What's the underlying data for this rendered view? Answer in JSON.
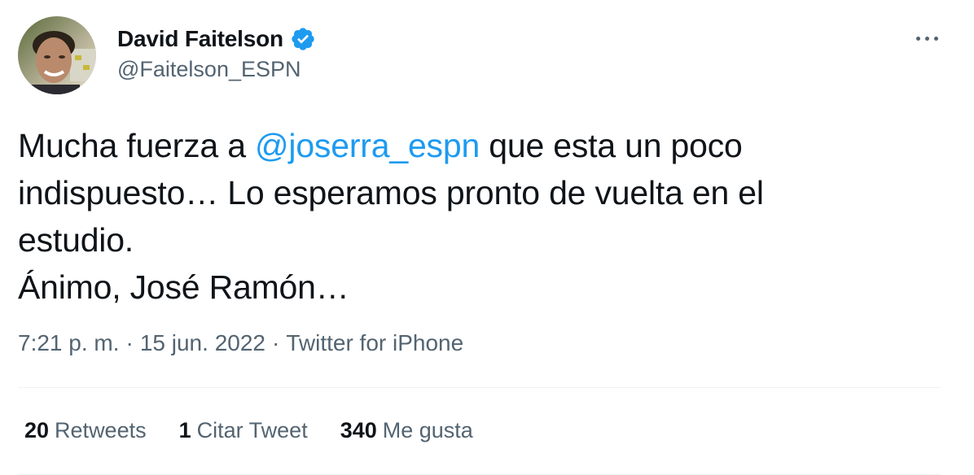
{
  "user": {
    "display_name": "David Faitelson",
    "handle": "@Faitelson_ESPN",
    "verified": true,
    "avatar_icon": "profile-photo"
  },
  "tweet": {
    "text_before_mention": "Mucha fuerza a ",
    "mention": "@joserra_espn",
    "text_after_mention": " que esta un poco",
    "line2": "indispuesto… Lo esperamos pronto de vuelta en el",
    "line3": "estudio.",
    "line4": "Ánimo, José Ramón…"
  },
  "meta": {
    "time": "7:21 p. m.",
    "separator": "·",
    "date": "15 jun. 2022",
    "source": "Twitter for iPhone"
  },
  "stats": {
    "retweets_count": "20",
    "retweets_label": "Retweets",
    "quotes_count": "1",
    "quotes_label": "Citar Tweet",
    "likes_count": "340",
    "likes_label": "Me gusta"
  },
  "icons": {
    "verified": "verified-badge-icon",
    "more": "more-options-icon"
  },
  "colors": {
    "text": "#0f1419",
    "secondary": "#536471",
    "accent": "#1d9bf0",
    "divider": "#eff3f4"
  }
}
